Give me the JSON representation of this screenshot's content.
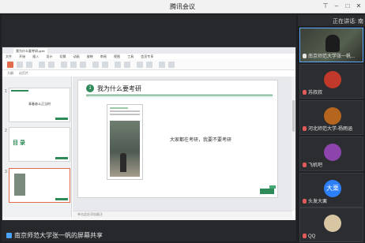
{
  "window": {
    "title": "腾讯会议"
  },
  "wps": {
    "tab_label": "我为什么要考研.pptx",
    "menu": [
      "文件",
      "开始",
      "插入",
      "设计",
      "切换",
      "动画",
      "放映",
      "审阅",
      "视图",
      "工具",
      "会员专享"
    ],
    "subtabs": [
      "大纲",
      "幻灯片"
    ],
    "thumbnails": [
      {
        "num": "1",
        "title": "青春奋斗正当时"
      },
      {
        "num": "2",
        "greentext": "目 录"
      },
      {
        "num": "3"
      }
    ],
    "slide": {
      "number": "1",
      "title": "我为什么要考研",
      "body": "大家都在考研，我要不要考研"
    },
    "notes": "单击此处添加备注"
  },
  "share": {
    "sharer": "南京师范大学张一帆的屏幕共享"
  },
  "participants": {
    "speaking": "正在讲话: 南",
    "tiles": [
      {
        "name": "南京师范大学张一帆...",
        "kind": "video",
        "mic": "on",
        "active": true
      },
      {
        "name": "苏叔叔",
        "kind": "avatar",
        "color": "#c0392b",
        "mic": "off"
      },
      {
        "name": "河北师范大学-杨雨涵",
        "kind": "avatar",
        "color": "#b5651d",
        "mic": "off"
      },
      {
        "name": "飞机吧",
        "kind": "avatar",
        "color": "#8e44ad",
        "mic": "off"
      },
      {
        "name": "头发大栗",
        "kind": "avatar-text",
        "label": "大栗",
        "mic": "off"
      },
      {
        "name": "QQ",
        "kind": "avatar",
        "color": "#d8c6a3",
        "mic": "off"
      }
    ]
  }
}
